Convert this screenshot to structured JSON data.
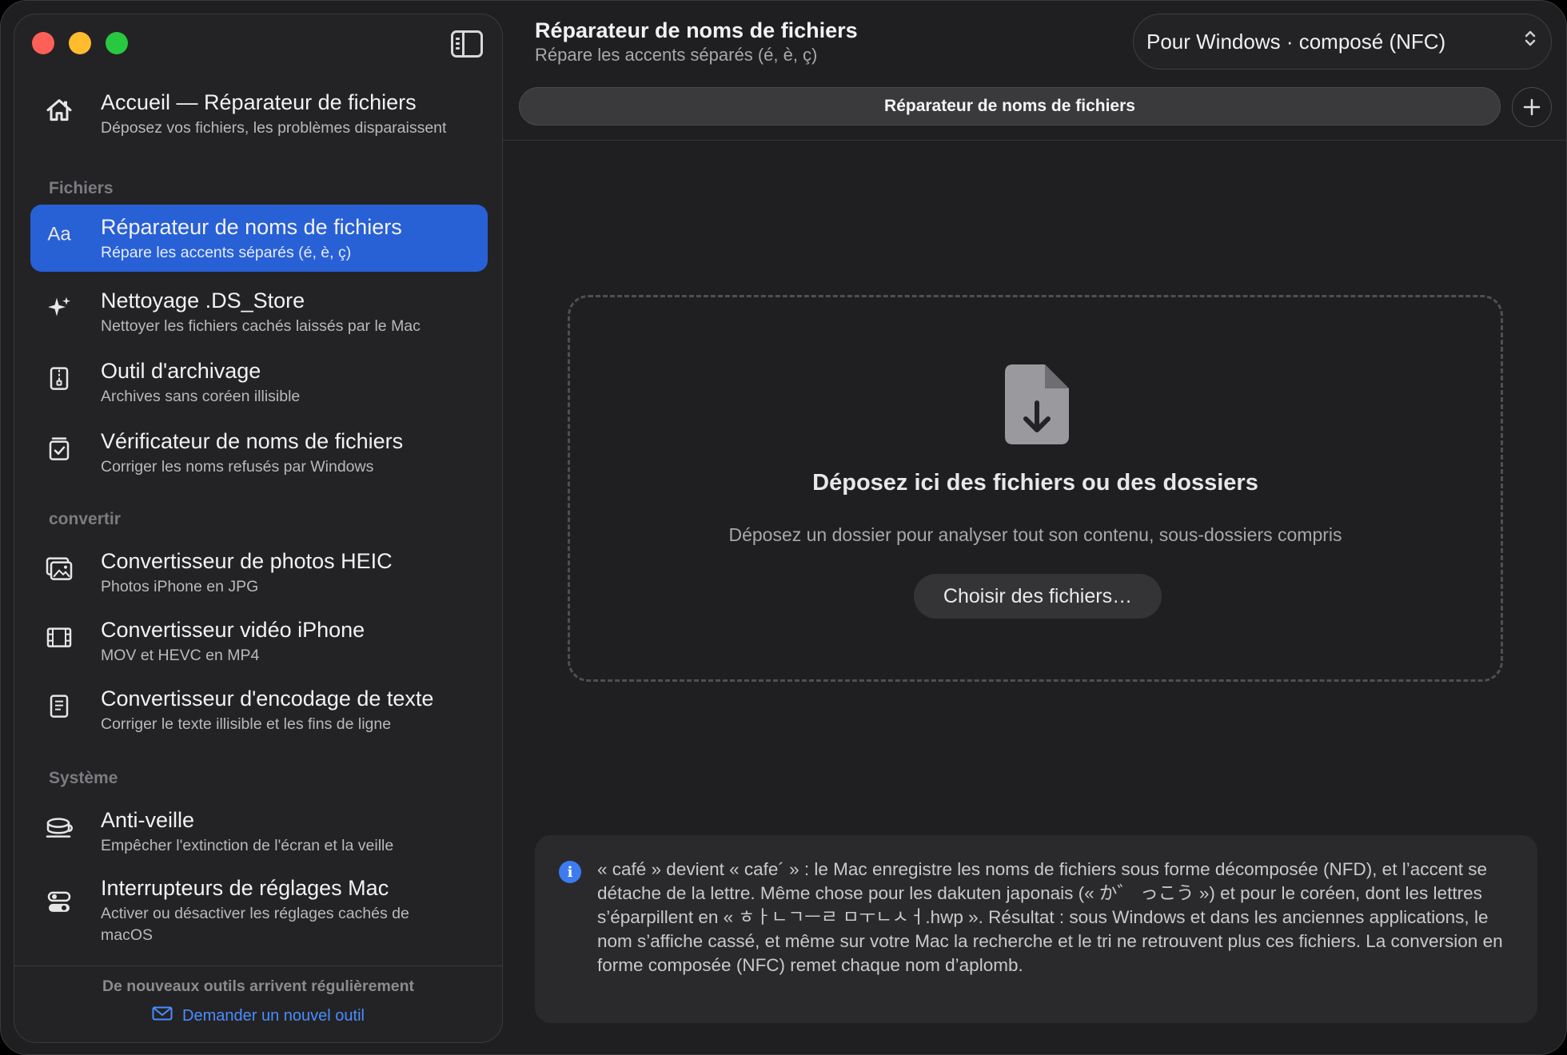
{
  "sidebar": {
    "home": {
      "title": "Accueil — Réparateur de fichiers",
      "sub": "Déposez vos fichiers, les problèmes disparaissent"
    },
    "section_files": "Fichiers",
    "section_convert": "convertir",
    "section_system": "Système",
    "items": [
      {
        "icon": "Aa",
        "title": "Réparateur de noms de fichiers",
        "sub": "Répare les accents séparés (é, è, ç)"
      },
      {
        "icon": "sparkle-icon",
        "title": "Nettoyage .DS_Store",
        "sub": "Nettoyer les fichiers cachés laissés par le Mac"
      },
      {
        "icon": "archive-icon",
        "title": "Outil d'archivage",
        "sub": "Archives sans coréen illisible"
      },
      {
        "icon": "checkbox-doc-icon",
        "title": "Vérificateur de noms de fichiers",
        "sub": "Corriger les noms refusés par Windows"
      },
      {
        "icon": "photo-stack-icon",
        "title": "Convertisseur de photos HEIC",
        "sub": "Photos iPhone en JPG"
      },
      {
        "icon": "film-icon",
        "title": "Convertisseur vidéo iPhone",
        "sub": "MOV et HEVC en MP4"
      },
      {
        "icon": "text-doc-icon",
        "title": "Convertisseur d'encodage de texte",
        "sub": "Corriger le texte illisible et les fins de ligne"
      },
      {
        "icon": "coffee-icon",
        "title": "Anti-veille",
        "sub": "Empêcher l'extinction de l'écran et la veille"
      },
      {
        "icon": "toggles-icon",
        "title": "Interrupteurs de réglages Mac",
        "sub": "Activer ou désactiver les réglages cachés de macOS"
      }
    ],
    "footer_note": "De nouveaux outils arrivent régulièrement",
    "footer_link": "Demander un nouvel outil"
  },
  "main": {
    "title": "Réparateur de noms de fichiers",
    "subtitle": "Répare les accents séparés (é, è, ç)",
    "mode_value": "Pour Windows · composé (NFC)",
    "tab_label": "Réparateur de noms de fichiers",
    "drop_title": "Déposez ici des fichiers ou des dossiers",
    "drop_sub": "Déposez un dossier pour analyser tout son contenu, sous-dossiers compris",
    "choose_button": "Choisir des fichiers…",
    "info_text": "« café » devient « cafe´ » : le Mac enregistre les noms de fichiers sous forme décomposée (NFD), et l’accent se détache de la lettre. Même chose pour les dakuten japonais (« か゛ っこう ») et pour le coréen, dont les lettres s’éparpillent en « ㅎㅏㄴㄱㅡㄹ ㅁㅜㄴㅅㅓ.hwp ». Résultat : sous Windows et dans les anciennes applications, le nom s’affiche cassé, et même sur votre Mac la recherche et le tri ne retrouvent plus ces fichiers. La conversion en forme composée (NFC) remet chaque nom d’aplomb."
  },
  "colors": {
    "accent": "#2860d6",
    "link": "#4a8cff",
    "info": "#3d7bf0"
  }
}
